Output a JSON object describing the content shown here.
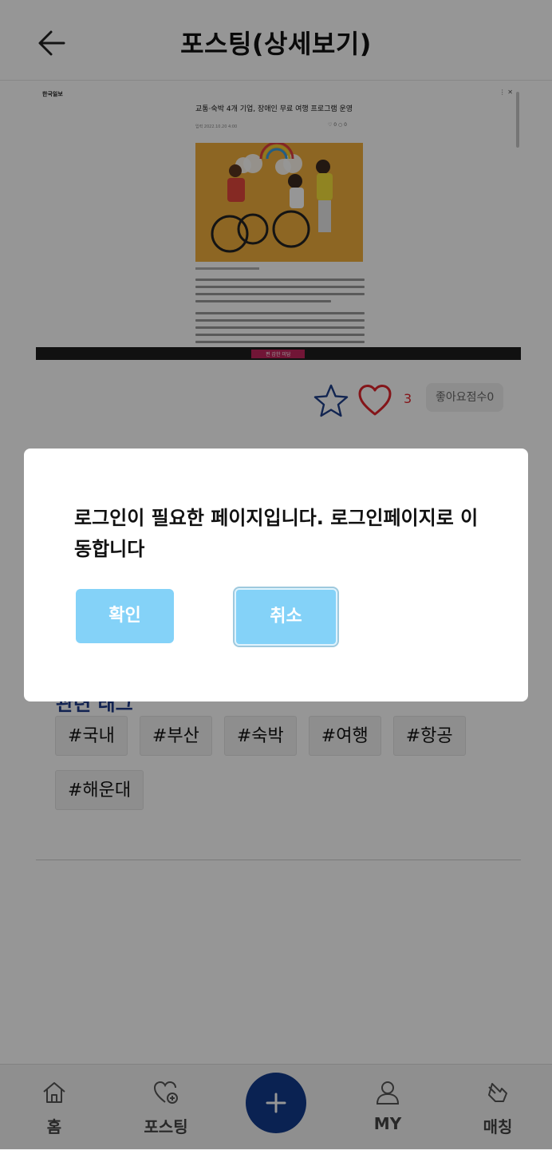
{
  "header": {
    "title": "포스팅(상세보기)"
  },
  "article": {
    "publisher": "한국일보",
    "menu": "⋮  ✕",
    "title": "교통·숙박 4개 기업, 장애인 무료 여행 프로그램 운영",
    "date": "입력 2022.10.20 4:00",
    "meta": "♡ 0   ○ 0",
    "ad_label": "편 감한 미담"
  },
  "actions": {
    "like_count": "3",
    "like_score": "좋아요점수0"
  },
  "tags": {
    "heading": "관련 태그",
    "items": [
      "#국내",
      "#부산",
      "#숙박",
      "#여행",
      "#항공",
      "#해운대"
    ]
  },
  "nav": {
    "items": [
      {
        "label": "홈",
        "icon": "home-icon"
      },
      {
        "label": "포스팅",
        "icon": "heart-plus-icon"
      },
      {
        "label": "MY",
        "icon": "person-icon"
      },
      {
        "label": "매칭",
        "icon": "hand-pointer-icon"
      }
    ],
    "fab_icon": "plus-icon"
  },
  "dialog": {
    "message": "로그인이 필요한 페이지입니다. 로그인페이지로 이동합니다",
    "confirm_label": "확인",
    "cancel_label": "취소"
  },
  "colors": {
    "accent": "#84d2f8",
    "fab": "#123a8c",
    "like": "#e0242c",
    "heading": "#1e3a8a"
  }
}
